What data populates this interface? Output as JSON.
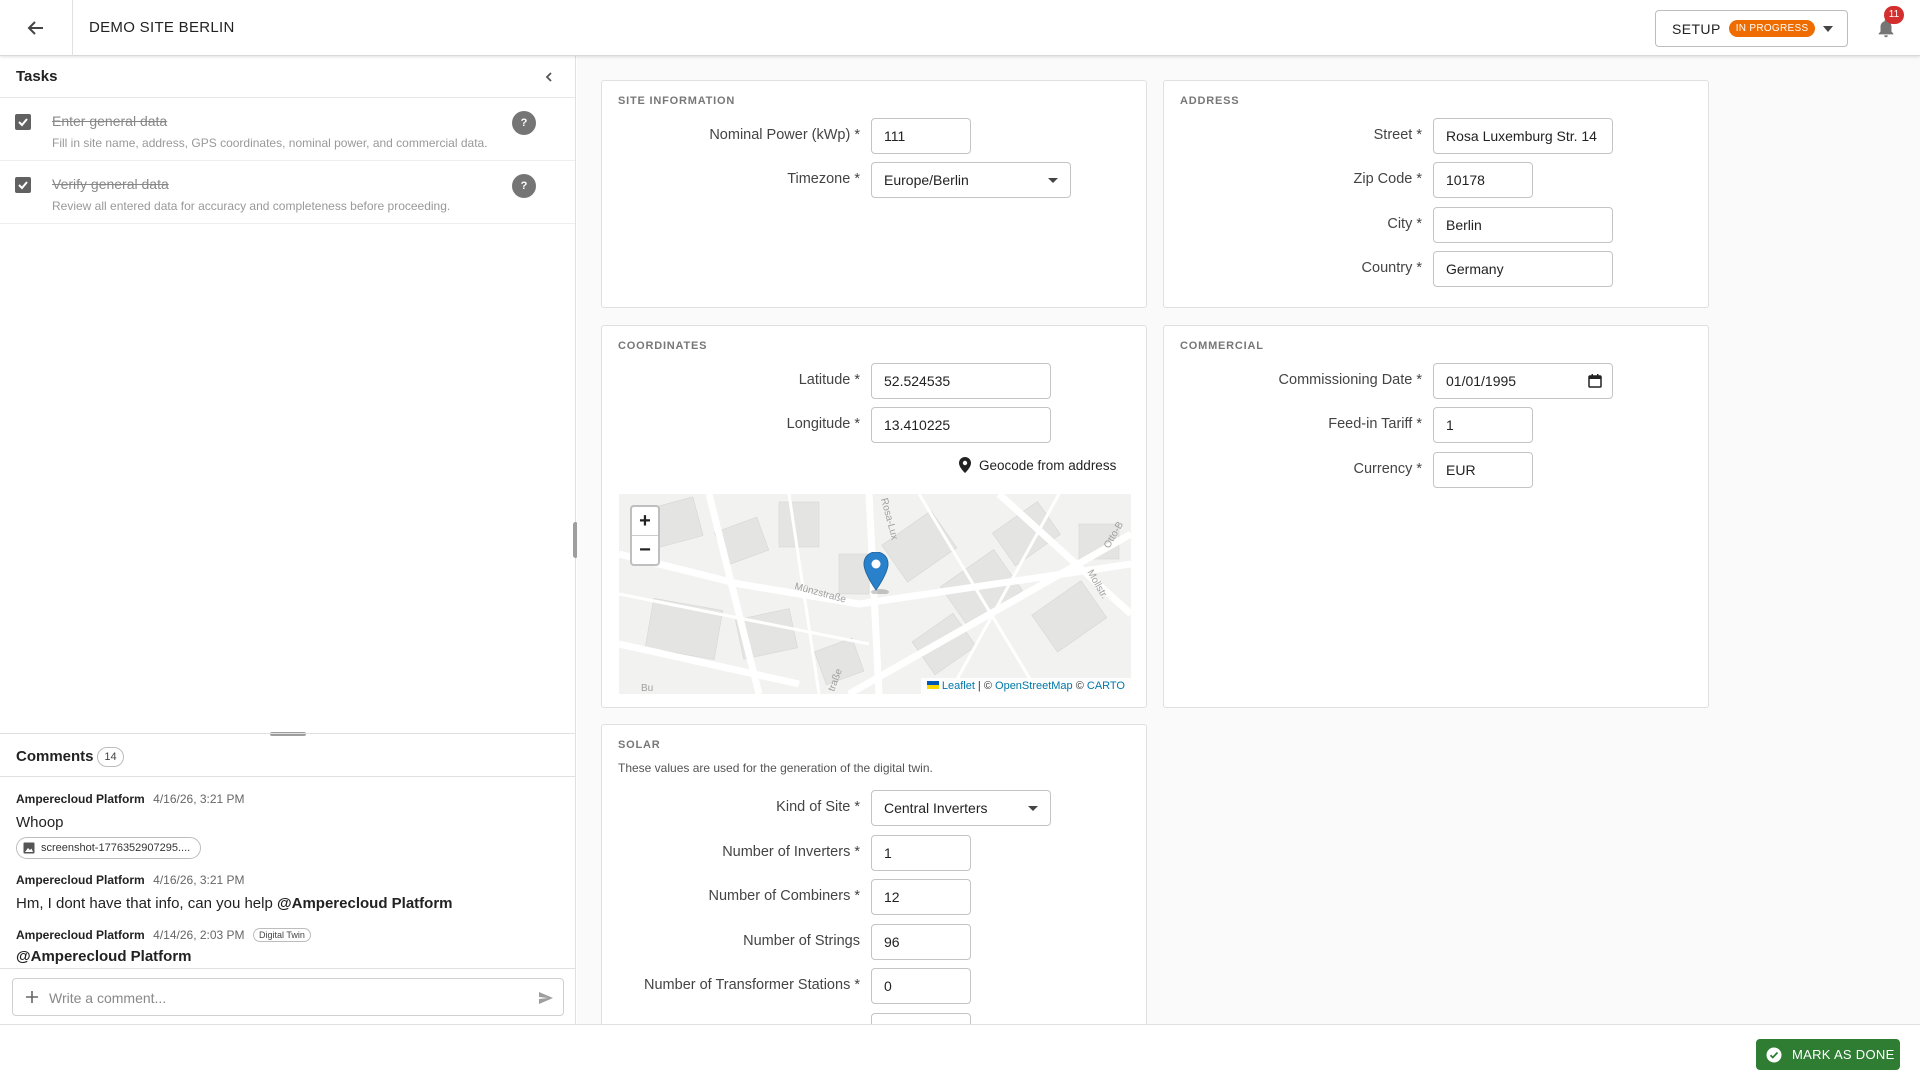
{
  "header": {
    "site_title": "DEMO SITE BERLIN",
    "setup_label": "SETUP",
    "setup_status": "IN PROGRESS",
    "notification_count": "11",
    "status_color": "#ef6c00"
  },
  "tasks": {
    "title": "Tasks",
    "items": [
      {
        "title": "Enter general data",
        "description": "Fill in site name, address, GPS coordinates, nominal power, and commercial data.",
        "help": "?",
        "checked": true
      },
      {
        "title": "Verify general data",
        "description": "Review all entered data for accuracy and completeness before proceeding.",
        "help": "?",
        "checked": true
      }
    ]
  },
  "comments": {
    "title": "Comments",
    "count": "14",
    "items": [
      {
        "author": "Amperecloud Platform",
        "time": "4/16/26, 3:21 PM",
        "text": "Whoop",
        "attachment": "screenshot-1776352907295...."
      },
      {
        "author": "Amperecloud Platform",
        "time": "4/16/26, 3:21 PM",
        "text": "Hm, I dont have that info, can you help ",
        "mention": "@Amperecloud Platform"
      },
      {
        "author": "Amperecloud Platform",
        "time": "4/14/26, 2:03 PM",
        "tag": "Digital Twin",
        "mention": "@Amperecloud Platform"
      }
    ],
    "input_placeholder": "Write a comment..."
  },
  "site_information": {
    "title": "SITE INFORMATION",
    "nominal_power_label": "Nominal Power (kWp) *",
    "nominal_power_value": "111",
    "timezone_label": "Timezone *",
    "timezone_value": "Europe/Berlin"
  },
  "address": {
    "title": "ADDRESS",
    "street_label": "Street *",
    "street_value": "Rosa Luxemburg Str. 14",
    "zip_label": "Zip Code *",
    "zip_value": "10178",
    "city_label": "City *",
    "city_value": "Berlin",
    "country_label": "Country *",
    "country_value": "Germany"
  },
  "coordinates": {
    "title": "COORDINATES",
    "latitude_label": "Latitude *",
    "latitude_value": "52.524535",
    "longitude_label": "Longitude *",
    "longitude_value": "13.410225",
    "geocode_label": "Geocode from address",
    "map": {
      "zoom_in": "+",
      "zoom_out": "−",
      "attr_leaflet": "Leaflet",
      "attr_sep": " | © ",
      "attr_osm": "OpenStreetMap",
      "attr_copy": " © ",
      "attr_carto": "CARTO",
      "street_muenzstrasse": "Münzstraße",
      "street_mollstrasse": "Mollstr.",
      "street_otto": "Otto-B",
      "street_rosa": "Rosa-Lux",
      "street_bottom": "Bu",
      "street_strasse": "traße"
    }
  },
  "commercial": {
    "title": "COMMERCIAL",
    "commissioning_label": "Commissioning Date *",
    "commissioning_value": "01/01/1995",
    "tariff_label": "Feed-in Tariff *",
    "tariff_value": "1",
    "currency_label": "Currency *",
    "currency_value": "EUR"
  },
  "solar": {
    "title": "SOLAR",
    "subtitle": "These values are used for the generation of the digital twin.",
    "kind_label": "Kind of Site *",
    "kind_value": "Central Inverters",
    "inverters_label": "Number of Inverters *",
    "inverters_value": "1",
    "combiners_label": "Number of Combiners *",
    "combiners_value": "12",
    "strings_label": "Number of Strings",
    "strings_value": "96",
    "transformers_label": "Number of Transformer Stations *",
    "transformers_value": "0"
  },
  "footer": {
    "mark_done_label": "MARK AS DONE",
    "done_color": "#2e7d32"
  }
}
